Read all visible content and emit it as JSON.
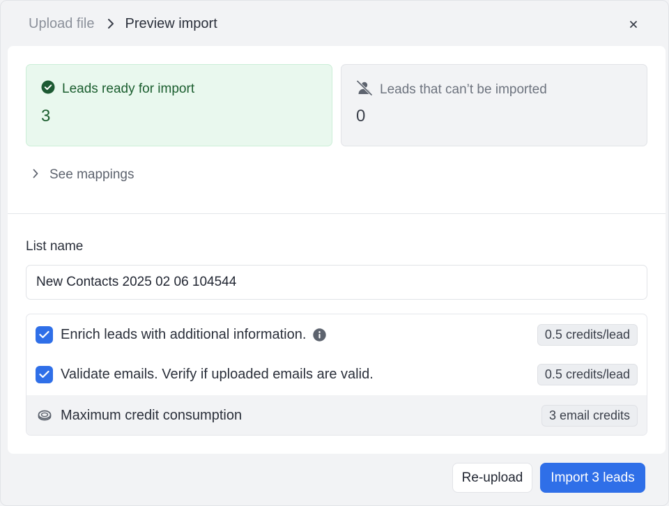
{
  "breadcrumb": {
    "step1": "Upload file",
    "step2": "Preview import"
  },
  "close": {
    "glyph": "×",
    "icon": "close-icon"
  },
  "stats": {
    "ready": {
      "label": "Leads ready for import",
      "value": "3",
      "icon": "check-circle-icon",
      "color": "#1b5e2f"
    },
    "failed": {
      "label": "Leads that can’t be imported",
      "value": "0",
      "icon": "user-off-icon"
    }
  },
  "mappings": {
    "label": "See mappings",
    "icon": "chevron-right-icon"
  },
  "list": {
    "label": "List name",
    "value": "New Contacts 2025 02 06 104544"
  },
  "options": {
    "enrich": {
      "label": "Enrich leads with additional information.",
      "checked": true,
      "badge": "0.5 credits/lead"
    },
    "validate": {
      "label": "Validate emails. Verify if uploaded emails are valid.",
      "checked": true,
      "badge": "0.5 credits/lead"
    },
    "max": {
      "label": "Maximum credit consumption",
      "badge": "3 email credits",
      "icon": "coins-icon"
    }
  },
  "footer": {
    "reupload": "Re-upload",
    "import": "Import 3 leads"
  },
  "colors": {
    "accent": "#2f6fe8",
    "success_bg": "#e9f8ee"
  }
}
